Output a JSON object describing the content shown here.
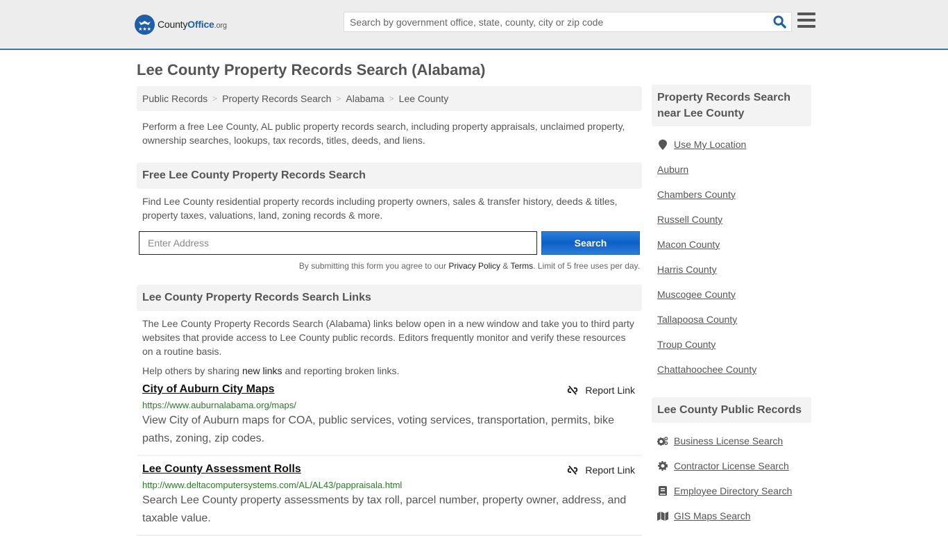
{
  "header": {
    "logo": {
      "brand_part1": "County",
      "brand_part2": "Office",
      "brand_tld": ".org",
      "icon": "eagle-stars-icon"
    },
    "search_placeholder": "Search by government office, state, county, city or zip code",
    "search_icon": "search-icon",
    "menu_icon": "hamburger-menu-icon"
  },
  "page_title": "Lee County Property Records Search (Alabama)",
  "breadcrumb": [
    "Public Records",
    "Property Records Search",
    "Alabama",
    "Lee County"
  ],
  "intro": "Perform a free Lee County, AL public property records search, including property appraisals, unclaimed property, ownership searches, lookups, tax records, titles, deeds, and liens.",
  "free_search": {
    "heading": "Free Lee County Property Records Search",
    "text": "Find Lee County residential property records including property owners, sales & transfer history, deeds & titles, property taxes, valuations, land, zoning records & more.",
    "address_placeholder": "Enter Address",
    "address_value": "",
    "button_label": "Search",
    "disclaimer_prefix": "By submitting this form you agree to our ",
    "privacy_label": "Privacy Policy",
    "amp": " & ",
    "terms_label": "Terms",
    "disclaimer_suffix": ". Limit of 5 free uses per day."
  },
  "links_section": {
    "heading": "Lee County Property Records Search Links",
    "text": "The Lee County Property Records Search (Alabama) links below open in a new window and take you to third party websites that provide access to Lee County public records. Editors frequently monitor and verify these resources on a routine basis.",
    "help_prefix": "Help others by sharing ",
    "help_link": "new links",
    "help_suffix": " and reporting broken links.",
    "report_label": "Report Link",
    "items": [
      {
        "title": "City of Auburn City Maps",
        "url": "https://www.auburnalabama.org/maps/",
        "description": "View City of Auburn maps for COA, public services, voting services, transportation, permits, bike paths, zoning, zip codes."
      },
      {
        "title": "Lee County Assessment Rolls",
        "url": "http://www.deltacomputersystems.com/AL/AL43/pappraisala.html",
        "description": "Search Lee County property assessments by tax roll, parcel number, property owner, address, and taxable value."
      }
    ]
  },
  "sidebar": {
    "nearby_heading": "Property Records Search near Lee County",
    "use_location": "Use My Location",
    "nearby": [
      "Auburn",
      "Chambers County",
      "Russell County",
      "Macon County",
      "Harris County",
      "Muscogee County",
      "Tallapoosa County",
      "Troup County",
      "Chattahoochee County"
    ],
    "public_heading": "Lee County Public Records",
    "public_records": [
      {
        "label": "Business License Search",
        "icon": "cogs-icon"
      },
      {
        "label": "Contractor License Search",
        "icon": "gear-icon"
      },
      {
        "label": "Employee Directory Search",
        "icon": "book-icon"
      },
      {
        "label": "GIS Maps Search",
        "icon": "map-icon"
      }
    ]
  },
  "colors": {
    "brand_blue": "#1e5fa8",
    "header_border": "#3a77aa",
    "url_green": "#2a7a2a",
    "button_blue": "#0b5fc7"
  }
}
